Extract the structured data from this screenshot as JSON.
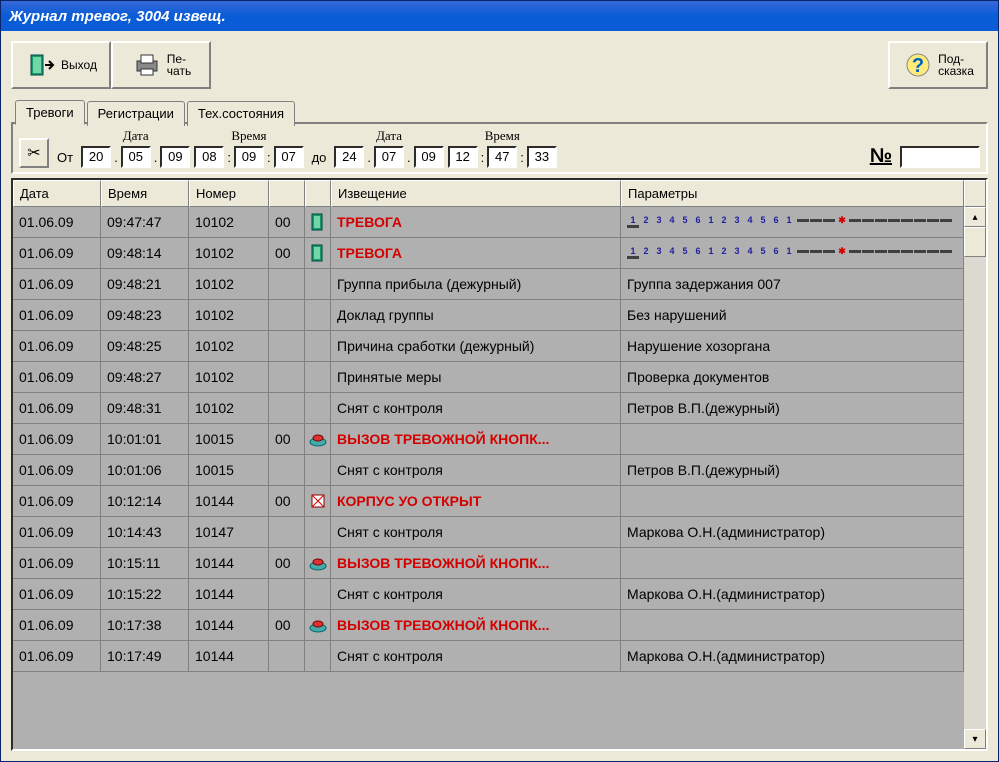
{
  "title": "Журнал тревог, 3004 извещ.",
  "toolbar": {
    "exit_label": "Выход",
    "print_label": "Пе-\nчать",
    "hint_label": "Под-\nсказка"
  },
  "tabs": {
    "alarms": "Тревоги",
    "registrations": "Регистрации",
    "tech_status": "Тех.состояния"
  },
  "filter": {
    "date_label_from": "Дата",
    "time_label_from": "Время",
    "date_label_to": "Дата",
    "time_label_to": "Время",
    "from_label": "От",
    "to_label": "до",
    "from_d": "20",
    "from_m": "05",
    "from_y": "09",
    "from_h": "08",
    "from_mi": "09",
    "from_s": "07",
    "to_d": "24",
    "to_m": "07",
    "to_y": "09",
    "to_h": "12",
    "to_mi": "47",
    "to_s": "33",
    "number_label": "№",
    "number_value": ""
  },
  "columns": {
    "date": "Дата",
    "time": "Время",
    "number": "Номер",
    "code": "",
    "message": "Извещение",
    "params": "Параметры"
  },
  "rows": [
    {
      "date": "01.06.09",
      "time": "09:47:47",
      "num": "10102",
      "code": "00",
      "icon": "door",
      "msg": "ТРЕВОГА",
      "alarm": true,
      "param_type": "grid",
      "param": ""
    },
    {
      "date": "01.06.09",
      "time": "09:48:14",
      "num": "10102",
      "code": "00",
      "icon": "door",
      "msg": "ТРЕВОГА",
      "alarm": true,
      "param_type": "grid",
      "param": ""
    },
    {
      "date": "01.06.09",
      "time": "09:48:21",
      "num": "10102",
      "code": "",
      "icon": "",
      "msg": "Группа прибыла (дежурный)",
      "alarm": false,
      "param": "Группа задержания 007"
    },
    {
      "date": "01.06.09",
      "time": "09:48:23",
      "num": "10102",
      "code": "",
      "icon": "",
      "msg": "Доклад группы",
      "alarm": false,
      "param": "Без нарушений"
    },
    {
      "date": "01.06.09",
      "time": "09:48:25",
      "num": "10102",
      "code": "",
      "icon": "",
      "msg": "Причина сработки (дежурный)",
      "alarm": false,
      "param": "Нарушение хозоргана"
    },
    {
      "date": "01.06.09",
      "time": "09:48:27",
      "num": "10102",
      "code": "",
      "icon": "",
      "msg": "Принятые меры",
      "alarm": false,
      "param": "Проверка документов"
    },
    {
      "date": "01.06.09",
      "time": "09:48:31",
      "num": "10102",
      "code": "",
      "icon": "",
      "msg": "Снят с контроля",
      "alarm": false,
      "param": "Петров В.П.(дежурный)"
    },
    {
      "date": "01.06.09",
      "time": "10:01:01",
      "num": "10015",
      "code": "00",
      "icon": "button",
      "msg": "ВЫЗОВ ТРЕВОЖНОЙ КНОПК...",
      "alarm": true,
      "param": ""
    },
    {
      "date": "01.06.09",
      "time": "10:01:06",
      "num": "10015",
      "code": "",
      "icon": "",
      "msg": "Снят с контроля",
      "alarm": false,
      "param": "Петров В.П.(дежурный)"
    },
    {
      "date": "01.06.09",
      "time": "10:12:14",
      "num": "10144",
      "code": "00",
      "icon": "box",
      "msg": "КОРПУС УО ОТКРЫТ",
      "alarm": true,
      "param": ""
    },
    {
      "date": "01.06.09",
      "time": "10:14:43",
      "num": "10147",
      "code": "",
      "icon": "",
      "msg": "Снят с контроля",
      "alarm": false,
      "param": "Маркова О.Н.(администратор)"
    },
    {
      "date": "01.06.09",
      "time": "10:15:11",
      "num": "10144",
      "code": "00",
      "icon": "button",
      "msg": "ВЫЗОВ ТРЕВОЖНОЙ КНОПК...",
      "alarm": true,
      "param": ""
    },
    {
      "date": "01.06.09",
      "time": "10:15:22",
      "num": "10144",
      "code": "",
      "icon": "",
      "msg": "Снят с контроля",
      "alarm": false,
      "param": "Маркова О.Н.(администратор)"
    },
    {
      "date": "01.06.09",
      "time": "10:17:38",
      "num": "10144",
      "code": "00",
      "icon": "button",
      "msg": "ВЫЗОВ ТРЕВОЖНОЙ КНОПК...",
      "alarm": true,
      "param": ""
    },
    {
      "date": "01.06.09",
      "time": "10:17:49",
      "num": "10144",
      "code": "",
      "icon": "",
      "msg": "Снят с контроля",
      "alarm": false,
      "param": "Маркова О.Н.(администратор)"
    }
  ]
}
